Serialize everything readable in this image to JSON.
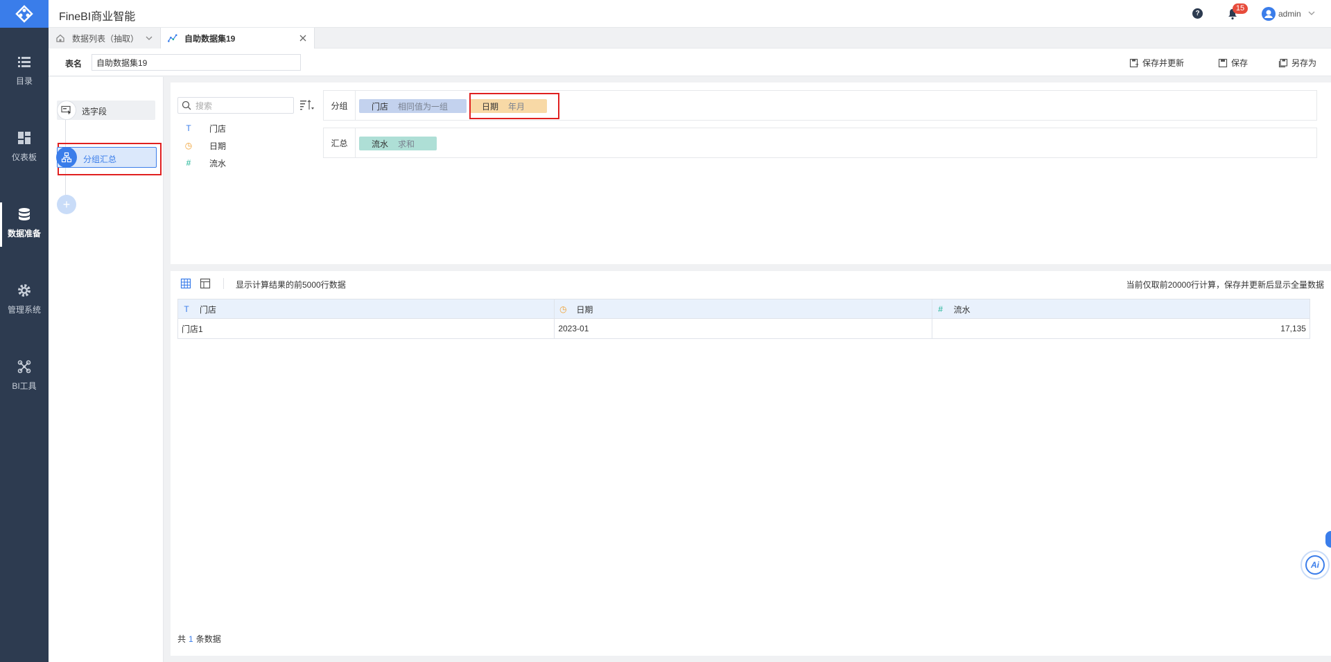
{
  "app": {
    "title": "FineBI商业智能"
  },
  "nav": [
    {
      "label": "目录",
      "icon": "list-icon"
    },
    {
      "label": "仪表板",
      "icon": "dashboard-icon"
    },
    {
      "label": "数据准备",
      "icon": "database-icon",
      "active": true
    },
    {
      "label": "管理系统",
      "icon": "gear-icon"
    },
    {
      "label": "BI工具",
      "icon": "tools-icon"
    }
  ],
  "header": {
    "notification_count": "15",
    "user": "admin",
    "help": "?"
  },
  "tabs": [
    {
      "label": "数据列表（抽取）"
    },
    {
      "label": "自助数据集19",
      "active": true
    }
  ],
  "namebar": {
    "label": "表名",
    "value": "自助数据集19",
    "actions": [
      "保存并更新",
      "保存",
      "另存为"
    ]
  },
  "steps": [
    {
      "label": "选字段"
    },
    {
      "label": "分组汇总",
      "active": true
    }
  ],
  "add_step": "+",
  "config": {
    "search_placeholder": "搜索",
    "fields": [
      {
        "name": "门店",
        "type": "text",
        "glyph": "T",
        "color": "#3a7dea"
      },
      {
        "name": "日期",
        "type": "date",
        "glyph": "◷",
        "color": "#f0a030"
      },
      {
        "name": "流水",
        "type": "number",
        "glyph": "#",
        "color": "#1ab394"
      }
    ],
    "group_label": "分组",
    "group_items": [
      {
        "name": "门店",
        "mode": "相同值为一组"
      },
      {
        "name": "日期",
        "mode": "年月"
      }
    ],
    "summary_label": "汇总",
    "summary_items": [
      {
        "name": "流水",
        "mode": "求和"
      }
    ]
  },
  "preview": {
    "left_text": "显示计算结果的前5000行数据",
    "right_text": "当前仅取前20000行计算，保存并更新后显示全量数据",
    "columns": [
      {
        "name": "门店",
        "glyph": "T",
        "color": "#3a7dea"
      },
      {
        "name": "日期",
        "glyph": "◷",
        "color": "#f0a030"
      },
      {
        "name": "流水",
        "glyph": "#",
        "color": "#1ab394"
      }
    ],
    "rows": [
      [
        "门店1",
        "2023-01",
        "17,135"
      ]
    ],
    "footer_prefix": "共",
    "footer_count": "1",
    "footer_suffix": "条数据"
  },
  "ai_label": "Ai",
  "colors": {
    "accent": "#3a7dea",
    "nav_bg": "#2d3b50",
    "highlight": "#e02020"
  }
}
